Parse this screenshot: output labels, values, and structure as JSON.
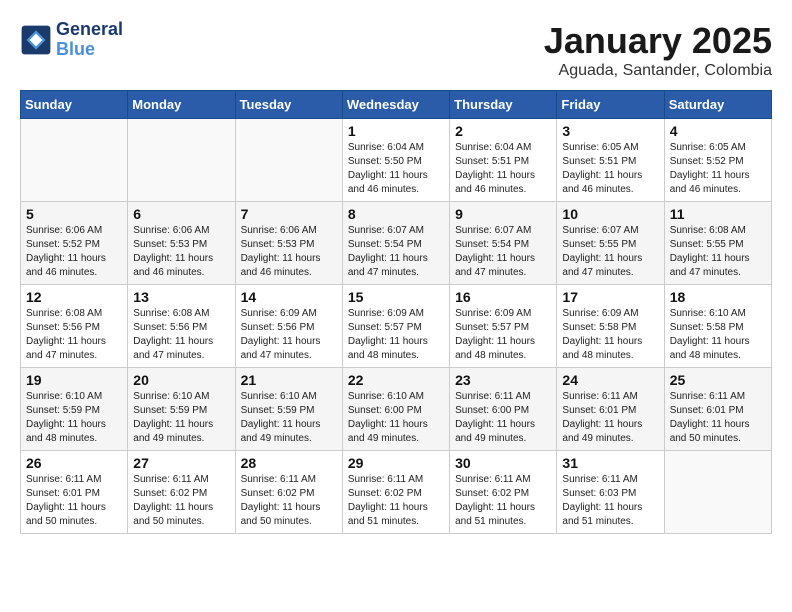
{
  "header": {
    "logo_general": "General",
    "logo_blue": "Blue",
    "month": "January 2025",
    "location": "Aguada, Santander, Colombia"
  },
  "weekdays": [
    "Sunday",
    "Monday",
    "Tuesday",
    "Wednesday",
    "Thursday",
    "Friday",
    "Saturday"
  ],
  "weeks": [
    [
      {
        "day": "",
        "info": ""
      },
      {
        "day": "",
        "info": ""
      },
      {
        "day": "",
        "info": ""
      },
      {
        "day": "1",
        "info": "Sunrise: 6:04 AM\nSunset: 5:50 PM\nDaylight: 11 hours\nand 46 minutes."
      },
      {
        "day": "2",
        "info": "Sunrise: 6:04 AM\nSunset: 5:51 PM\nDaylight: 11 hours\nand 46 minutes."
      },
      {
        "day": "3",
        "info": "Sunrise: 6:05 AM\nSunset: 5:51 PM\nDaylight: 11 hours\nand 46 minutes."
      },
      {
        "day": "4",
        "info": "Sunrise: 6:05 AM\nSunset: 5:52 PM\nDaylight: 11 hours\nand 46 minutes."
      }
    ],
    [
      {
        "day": "5",
        "info": "Sunrise: 6:06 AM\nSunset: 5:52 PM\nDaylight: 11 hours\nand 46 minutes."
      },
      {
        "day": "6",
        "info": "Sunrise: 6:06 AM\nSunset: 5:53 PM\nDaylight: 11 hours\nand 46 minutes."
      },
      {
        "day": "7",
        "info": "Sunrise: 6:06 AM\nSunset: 5:53 PM\nDaylight: 11 hours\nand 46 minutes."
      },
      {
        "day": "8",
        "info": "Sunrise: 6:07 AM\nSunset: 5:54 PM\nDaylight: 11 hours\nand 47 minutes."
      },
      {
        "day": "9",
        "info": "Sunrise: 6:07 AM\nSunset: 5:54 PM\nDaylight: 11 hours\nand 47 minutes."
      },
      {
        "day": "10",
        "info": "Sunrise: 6:07 AM\nSunset: 5:55 PM\nDaylight: 11 hours\nand 47 minutes."
      },
      {
        "day": "11",
        "info": "Sunrise: 6:08 AM\nSunset: 5:55 PM\nDaylight: 11 hours\nand 47 minutes."
      }
    ],
    [
      {
        "day": "12",
        "info": "Sunrise: 6:08 AM\nSunset: 5:56 PM\nDaylight: 11 hours\nand 47 minutes."
      },
      {
        "day": "13",
        "info": "Sunrise: 6:08 AM\nSunset: 5:56 PM\nDaylight: 11 hours\nand 47 minutes."
      },
      {
        "day": "14",
        "info": "Sunrise: 6:09 AM\nSunset: 5:56 PM\nDaylight: 11 hours\nand 47 minutes."
      },
      {
        "day": "15",
        "info": "Sunrise: 6:09 AM\nSunset: 5:57 PM\nDaylight: 11 hours\nand 48 minutes."
      },
      {
        "day": "16",
        "info": "Sunrise: 6:09 AM\nSunset: 5:57 PM\nDaylight: 11 hours\nand 48 minutes."
      },
      {
        "day": "17",
        "info": "Sunrise: 6:09 AM\nSunset: 5:58 PM\nDaylight: 11 hours\nand 48 minutes."
      },
      {
        "day": "18",
        "info": "Sunrise: 6:10 AM\nSunset: 5:58 PM\nDaylight: 11 hours\nand 48 minutes."
      }
    ],
    [
      {
        "day": "19",
        "info": "Sunrise: 6:10 AM\nSunset: 5:59 PM\nDaylight: 11 hours\nand 48 minutes."
      },
      {
        "day": "20",
        "info": "Sunrise: 6:10 AM\nSunset: 5:59 PM\nDaylight: 11 hours\nand 49 minutes."
      },
      {
        "day": "21",
        "info": "Sunrise: 6:10 AM\nSunset: 5:59 PM\nDaylight: 11 hours\nand 49 minutes."
      },
      {
        "day": "22",
        "info": "Sunrise: 6:10 AM\nSunset: 6:00 PM\nDaylight: 11 hours\nand 49 minutes."
      },
      {
        "day": "23",
        "info": "Sunrise: 6:11 AM\nSunset: 6:00 PM\nDaylight: 11 hours\nand 49 minutes."
      },
      {
        "day": "24",
        "info": "Sunrise: 6:11 AM\nSunset: 6:01 PM\nDaylight: 11 hours\nand 49 minutes."
      },
      {
        "day": "25",
        "info": "Sunrise: 6:11 AM\nSunset: 6:01 PM\nDaylight: 11 hours\nand 50 minutes."
      }
    ],
    [
      {
        "day": "26",
        "info": "Sunrise: 6:11 AM\nSunset: 6:01 PM\nDaylight: 11 hours\nand 50 minutes."
      },
      {
        "day": "27",
        "info": "Sunrise: 6:11 AM\nSunset: 6:02 PM\nDaylight: 11 hours\nand 50 minutes."
      },
      {
        "day": "28",
        "info": "Sunrise: 6:11 AM\nSunset: 6:02 PM\nDaylight: 11 hours\nand 50 minutes."
      },
      {
        "day": "29",
        "info": "Sunrise: 6:11 AM\nSunset: 6:02 PM\nDaylight: 11 hours\nand 51 minutes."
      },
      {
        "day": "30",
        "info": "Sunrise: 6:11 AM\nSunset: 6:02 PM\nDaylight: 11 hours\nand 51 minutes."
      },
      {
        "day": "31",
        "info": "Sunrise: 6:11 AM\nSunset: 6:03 PM\nDaylight: 11 hours\nand 51 minutes."
      },
      {
        "day": "",
        "info": ""
      }
    ]
  ]
}
